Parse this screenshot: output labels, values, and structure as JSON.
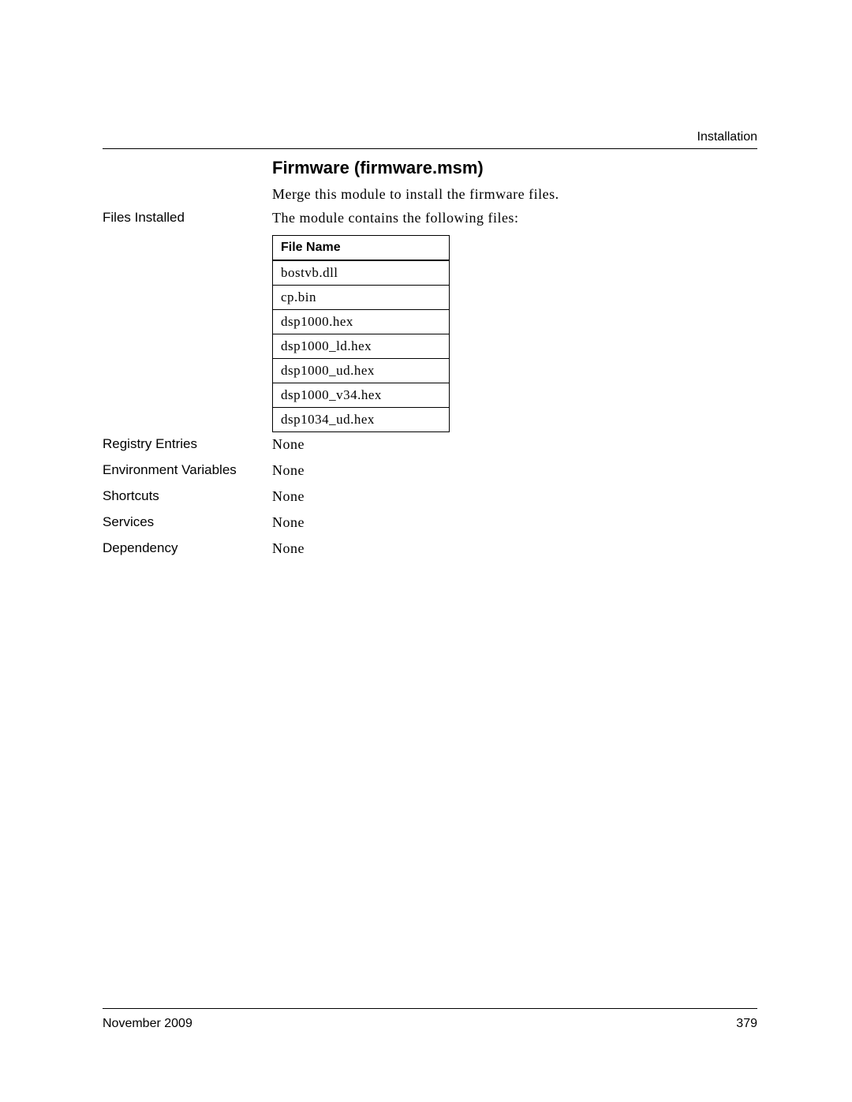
{
  "header": {
    "section_label": "Installation"
  },
  "title": "Firmware (firmware.msm)",
  "intro": "Merge this module to install the firmware files.",
  "rows": {
    "files_installed": {
      "label": "Files Installed",
      "value": "The module contains the following files:"
    },
    "registry": {
      "label": "Registry Entries",
      "value": "None"
    },
    "env": {
      "label": "Environment Variables",
      "value": "None"
    },
    "shortcuts": {
      "label": "Shortcuts",
      "value": "None"
    },
    "services": {
      "label": "Services",
      "value": "None"
    },
    "dependency": {
      "label": "Dependency",
      "value": "None"
    }
  },
  "file_table": {
    "header": "File Name",
    "files": [
      "bostvb.dll",
      "cp.bin",
      "dsp1000.hex",
      "dsp1000_ld.hex",
      "dsp1000_ud.hex",
      "dsp1000_v34.hex",
      "dsp1034_ud.hex"
    ]
  },
  "footer": {
    "date": "November 2009",
    "page": "379"
  }
}
